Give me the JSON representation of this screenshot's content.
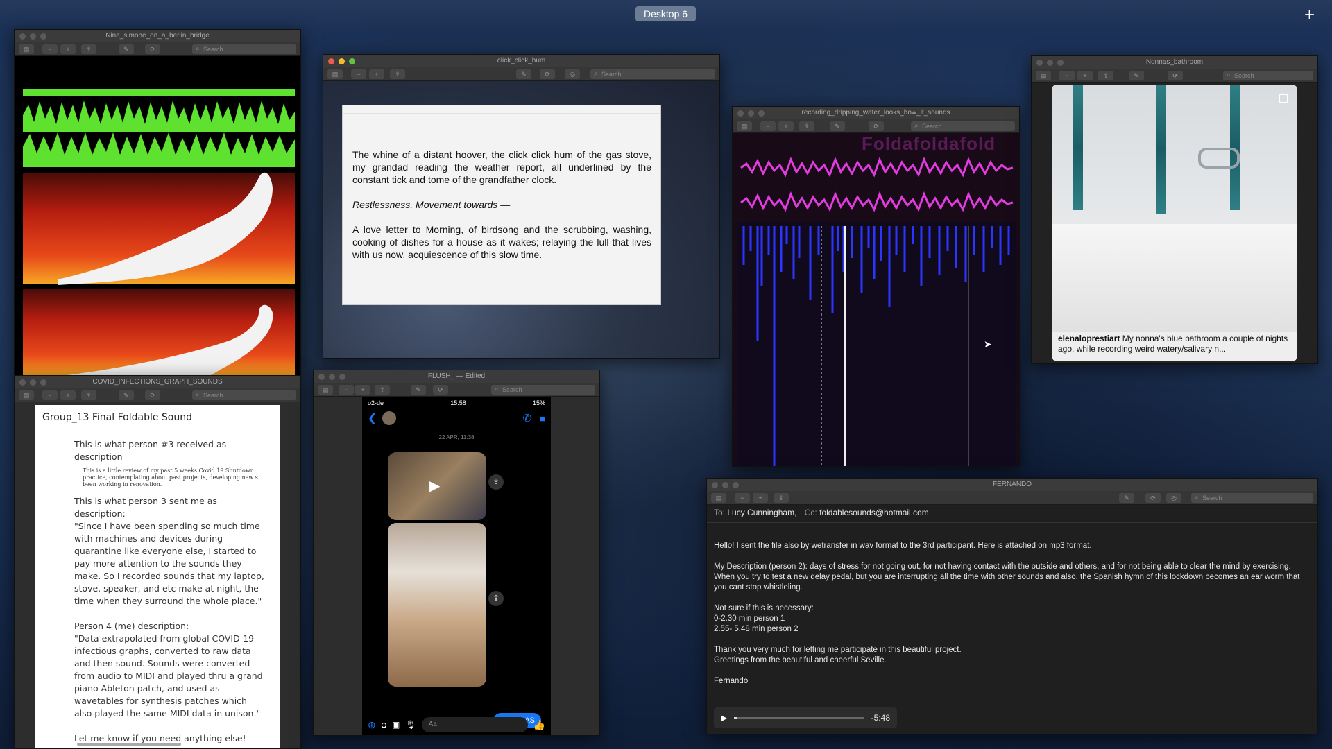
{
  "desktop": {
    "label": "Desktop 6",
    "add_icon": "plus-icon"
  },
  "windows": {
    "nina": {
      "title": "Nina_simone_on_a_berlin_bridge"
    },
    "click": {
      "title": "click_click_hum",
      "paragraph1": "The whine of a distant hoover, the click click hum of the gas stove, my grandad reading the weather report, all underlined by the constant tick and tome of the grandfather clock.",
      "paragraph2": "Restlessness. Movement towards —",
      "paragraph3": "A love letter to Morning, of birdsong and the scrubbing, washing, cooking of dishes for a house as it wakes; relaying the lull that lives with us now, acquiescence of this slow time."
    },
    "drip": {
      "title": "recording_dripping_water_looks_how_it_sounds",
      "overlay_text": "Foldafoldafold"
    },
    "nonna": {
      "title": "Nonnas_bathroom",
      "caption_user": "elenaloprestiart",
      "caption_text": "My nonna's blue bathroom a couple of nights ago, while recording weird watery/salivary n..."
    },
    "covid": {
      "title": "COVID_INFECTIONS_GRAPH_SOUNDS",
      "heading": "Group_13 Final Foldable Sound",
      "p3_label": "This is what person #3 received as description",
      "p3_small": "This is a little review of my past 5 weeks Covid 19 Shutdown. practice, contemplating about past projects, developing new s been working in renovation.",
      "p3_sent_label": "This is what person 3 sent me as description:",
      "p3_quote": "\"Since I have been spending so much time with machines and devices during quarantine like everyone else, I started to pay more attention to the sounds they make. So I recorded sounds that my laptop, stove, speaker, and etc make at night, the time when they surround the whole place.\"",
      "p4_label": "Person 4 (me) description:",
      "p4_quote": "\"Data extrapolated from global COVID-19 infectious graphs, converted to raw data and then sound. Sounds were converted from audio to MIDI and played thru a grand piano Ableton patch, and used as wavetables for synthesis patches which also played the same MIDI data in unison.\"",
      "closing": "Let me know if you need anything else!"
    },
    "flush": {
      "title": "FLUSH_ — Edited",
      "carrier": "o2-de",
      "time": "15:58",
      "battery": "15%",
      "date": "22 APR, 11:38",
      "message": "YAAAAAS",
      "input_placeholder": "Aa"
    },
    "fernando": {
      "title": "FERNANDO",
      "to_label": "To:",
      "to_value": "Lucy Cunningham,",
      "cc_label": "Cc:",
      "cc_value": "foldablesounds@hotmail.com",
      "line1": "Hello! I sent the file also by wetransfer in wav format to the 3rd participant. Here is attached on mp3 format.",
      "line2": "My Description (person 2): days of stress for not going out, for not having contact with the outside and others, and for not being able to clear the mind by exercising. When you try to test a new delay pedal, but you are interrupting all the time with other sounds and also, the Spanish hymn of this lockdown becomes an ear worm that you cant stop whistleling.",
      "line3": "Not sure if this is necessary:",
      "line4": "0-2.30 min person 1",
      "line5": "2.55- 5.48 min person 2",
      "line6": "Thank you very much for letting me participate in this beautiful project.",
      "line7": "Greetings from the beautiful and cheerful Seville.",
      "signature": "Fernando",
      "audio_time": "-5:48",
      "audio_progress": 0.02
    }
  },
  "search_placeholder": "Search",
  "colors": {
    "waveform_green": "#5fe12f",
    "waveform_magenta": "#e23ce0",
    "spectral_blue": "#2a36ff",
    "messenger_blue": "#1877f2"
  }
}
